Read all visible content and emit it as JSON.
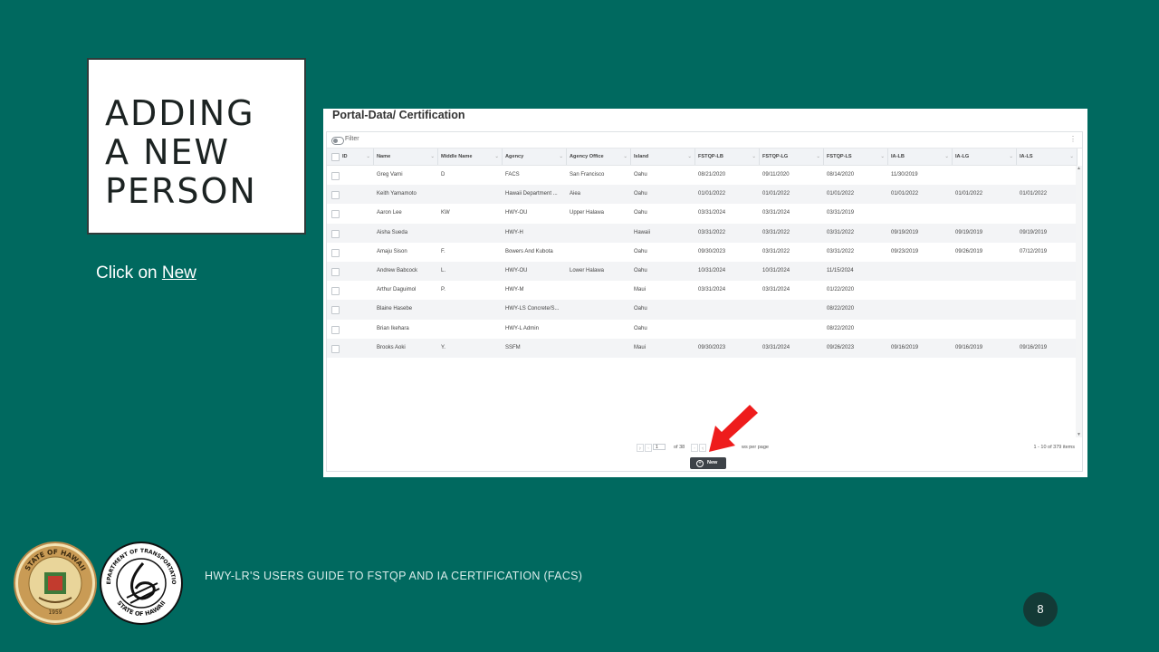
{
  "slide": {
    "title": "ADDING\nA NEW\nPERSON",
    "instruction_prefix": "Click on ",
    "instruction_link": "New",
    "footer": "HWY-LR'S USERS GUIDE TO FSTQP AND IA CERTIFICATION (FACS)",
    "page_number": "8"
  },
  "app": {
    "title": "Portal-Data/ Certification",
    "filter_label": "Filter",
    "columns": [
      "ID",
      "Name",
      "Middle Name",
      "Agency",
      "Agency Office",
      "Island",
      "FSTQP-LB",
      "FSTQP-LG",
      "FSTQP-LS",
      "IA-LB",
      "IA-LG",
      "IA-LS"
    ],
    "rows": [
      [
        "",
        "Greg Varni",
        "D",
        "FACS",
        "San Francisco",
        "Oahu",
        "08/21/2020",
        "09/11/2020",
        "08/14/2020",
        "11/30/2019",
        "",
        ""
      ],
      [
        "",
        "Keith Yamamoto",
        "",
        "Hawaii Department ...",
        "Aiea",
        "Oahu",
        "01/01/2022",
        "01/01/2022",
        "01/01/2022",
        "01/01/2022",
        "01/01/2022",
        "01/01/2022"
      ],
      [
        "",
        "Aaron Lee",
        "KW",
        "HWY-OU",
        "Upper Halawa",
        "Oahu",
        "03/31/2024",
        "03/31/2024",
        "03/31/2019",
        "",
        "",
        ""
      ],
      [
        "",
        "Aisha Sueda",
        "",
        "HWY-H",
        "",
        "Hawaii",
        "03/31/2022",
        "03/31/2022",
        "03/31/2022",
        "09/19/2019",
        "09/19/2019",
        "09/19/2019"
      ],
      [
        "",
        "Amaju Sison",
        "F.",
        "Bowers And Kubota",
        "",
        "Oahu",
        "09/30/2023",
        "03/31/2022",
        "03/31/2022",
        "09/23/2019",
        "09/26/2019",
        "07/12/2019"
      ],
      [
        "",
        "Andrew Babcock",
        "L.",
        "HWY-OU",
        "Lower Halawa",
        "Oahu",
        "10/31/2024",
        "10/31/2024",
        "11/15/2024",
        "",
        "",
        ""
      ],
      [
        "",
        "Arthur Daguimol",
        "P.",
        "HWY-M",
        "",
        "Maui",
        "03/31/2024",
        "03/31/2024",
        "01/22/2020",
        "",
        "",
        ""
      ],
      [
        "",
        "Blaine Hasebe",
        "",
        "HWY-LS Concrete/S...",
        "",
        "Oahu",
        "",
        "",
        "08/22/2020",
        "",
        "",
        ""
      ],
      [
        "",
        "Brian Ikehara",
        "",
        "HWY-L Admin",
        "",
        "Oahu",
        "",
        "",
        "08/22/2020",
        "",
        "",
        ""
      ],
      [
        "",
        "Brooks Aoki",
        "Y.",
        "SSFM",
        "",
        "Maui",
        "09/30/2023",
        "03/31/2024",
        "09/26/2023",
        "09/16/2019",
        "09/16/2019",
        "09/16/2019"
      ]
    ],
    "pager": {
      "page": "1",
      "of_pages": "of 38",
      "rows_per_page": "ws per page",
      "items": "1 - 10 of 379 items"
    },
    "new_button": "New"
  },
  "seals": {
    "hawaii_seal_text": "STATE OF HAWAII",
    "hawaii_seal_year": "1959",
    "dot_seal_text_top": "DEPARTMENT OF TRANSPORTATION",
    "dot_seal_text_bottom": "STATE OF HAWAII"
  },
  "colors": {
    "background": "#00695f",
    "accent_arrow": "#ee1c1c",
    "page_badge": "#133a36"
  }
}
